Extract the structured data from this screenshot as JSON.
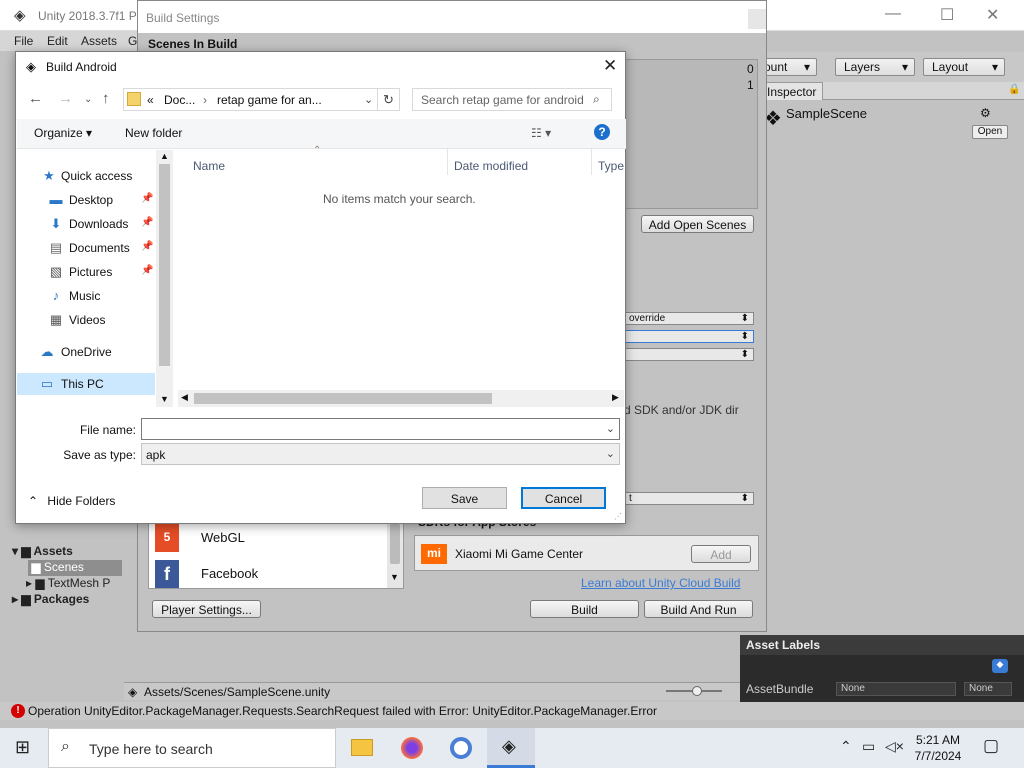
{
  "unity": {
    "title": "Unity 2018.3.7f1 Pe",
    "menu": [
      "File",
      "Edit",
      "Assets",
      "G"
    ],
    "toolbar": {
      "account": "ount",
      "layers": "Layers",
      "layout": "Layout"
    },
    "inspector": {
      "tab": "Inspector",
      "scene": "SampleScene",
      "open_btn": "Open"
    },
    "asset_labels": {
      "title": "Asset Labels",
      "asset_bundle": "AssetBundle",
      "none1": "None",
      "none2": "None"
    },
    "project": {
      "assets": "Assets",
      "scenes": "Scenes",
      "textmesh": "TextMesh P",
      "packages": "Packages"
    },
    "path": "Assets/Scenes/SampleScene.unity",
    "status_error": "Operation UnityEditor.PackageManager.Requests.SearchRequest failed with Error: UnityEditor.PackageManager.Error"
  },
  "build_settings": {
    "title": "Build Settings",
    "scenes_in_build": "Scenes In Build",
    "scene_index_0": "0",
    "scene_index_1": "1",
    "add_open_scenes": "Add Open Scenes",
    "override": "override",
    "sdk_note": "d SDK and/or JDK dir",
    "dd_t": "t",
    "platforms": [
      "WebGL",
      "Facebook"
    ],
    "sdk_title": "SDKs for App Stores",
    "sdk_item": "Xiaomi Mi Game Center",
    "add_btn": "Add",
    "learn_link": "Learn about Unity Cloud Build",
    "player_settings": "Player Settings...",
    "build": "Build",
    "build_and_run": "Build And Run"
  },
  "dialog": {
    "title": "Build Android",
    "address": {
      "chev": "«",
      "seg1": "Doc...",
      "sep": "›",
      "seg2": "retap game for an..."
    },
    "search_placeholder": "Search retap game for android",
    "organize": "Organize",
    "new_folder": "New folder",
    "nav": {
      "quick_access": "Quick access",
      "desktop": "Desktop",
      "downloads": "Downloads",
      "documents": "Documents",
      "pictures": "Pictures",
      "music": "Music",
      "videos": "Videos",
      "onedrive": "OneDrive",
      "this_pc": "This PC"
    },
    "columns": {
      "name": "Name",
      "date": "Date modified",
      "type": "Type"
    },
    "empty": "No items match your search.",
    "file_name_label": "File name:",
    "file_name_value": "",
    "save_type_label": "Save as type:",
    "save_type_value": "apk",
    "hide_folders": "Hide Folders",
    "save": "Save",
    "cancel": "Cancel"
  },
  "taskbar": {
    "search": "Type here to search",
    "time": "5:21 AM",
    "date": "7/7/2024"
  },
  "colors": {
    "accent": "#0078d7",
    "unity_grey": "#c2c2c2",
    "error": "#d40000"
  }
}
